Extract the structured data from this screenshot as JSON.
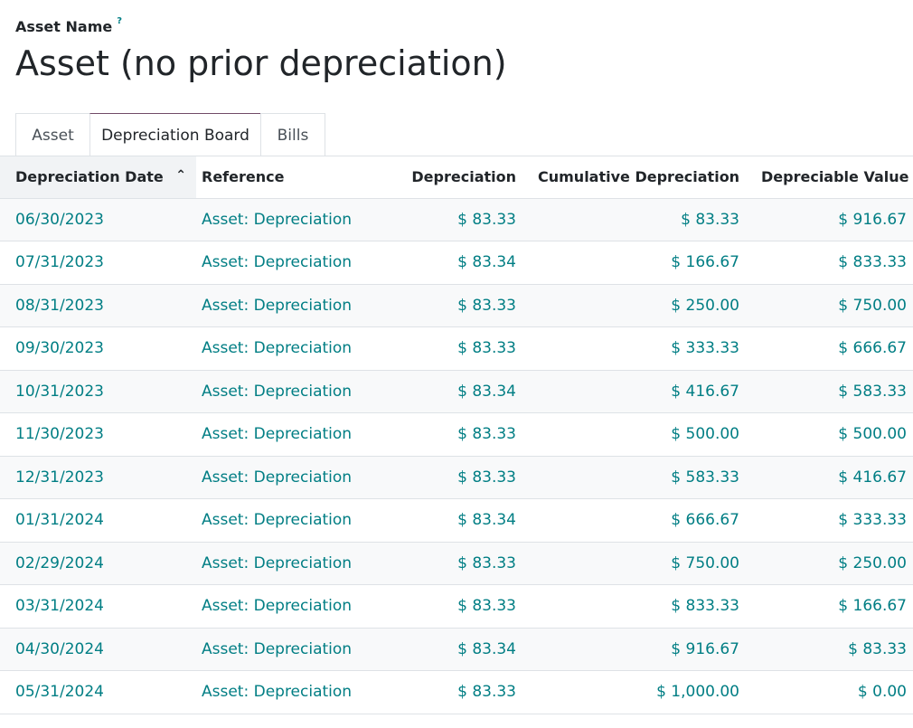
{
  "header": {
    "field_label": "Asset Name",
    "help_mark": "?",
    "title": "Asset (no prior depreciation)"
  },
  "tabs": [
    {
      "label": "Asset",
      "active": false
    },
    {
      "label": "Depreciation Board",
      "active": true
    },
    {
      "label": "Bills",
      "active": false
    }
  ],
  "table": {
    "columns": [
      "Depreciation Date",
      "Reference",
      "Depreciation",
      "Cumulative Depreciation",
      "Depreciable Value"
    ],
    "sort_icon": "chevron-up-icon",
    "rows": [
      [
        "06/30/2023",
        "Asset: Depreciation",
        "$ 83.33",
        "$ 83.33",
        "$ 916.67"
      ],
      [
        "07/31/2023",
        "Asset: Depreciation",
        "$ 83.34",
        "$ 166.67",
        "$ 833.33"
      ],
      [
        "08/31/2023",
        "Asset: Depreciation",
        "$ 83.33",
        "$ 250.00",
        "$ 750.00"
      ],
      [
        "09/30/2023",
        "Asset: Depreciation",
        "$ 83.33",
        "$ 333.33",
        "$ 666.67"
      ],
      [
        "10/31/2023",
        "Asset: Depreciation",
        "$ 83.34",
        "$ 416.67",
        "$ 583.33"
      ],
      [
        "11/30/2023",
        "Asset: Depreciation",
        "$ 83.33",
        "$ 500.00",
        "$ 500.00"
      ],
      [
        "12/31/2023",
        "Asset: Depreciation",
        "$ 83.33",
        "$ 583.33",
        "$ 416.67"
      ],
      [
        "01/31/2024",
        "Asset: Depreciation",
        "$ 83.34",
        "$ 666.67",
        "$ 333.33"
      ],
      [
        "02/29/2024",
        "Asset: Depreciation",
        "$ 83.33",
        "$ 750.00",
        "$ 250.00"
      ],
      [
        "03/31/2024",
        "Asset: Depreciation",
        "$ 83.33",
        "$ 833.33",
        "$ 166.67"
      ],
      [
        "04/30/2024",
        "Asset: Depreciation",
        "$ 83.34",
        "$ 916.67",
        "$ 83.33"
      ],
      [
        "05/31/2024",
        "Asset: Depreciation",
        "$ 83.33",
        "$ 1,000.00",
        "$ 0.00"
      ]
    ]
  },
  "colors": {
    "link": "#017e84",
    "active_tab_accent": "#714b67"
  }
}
